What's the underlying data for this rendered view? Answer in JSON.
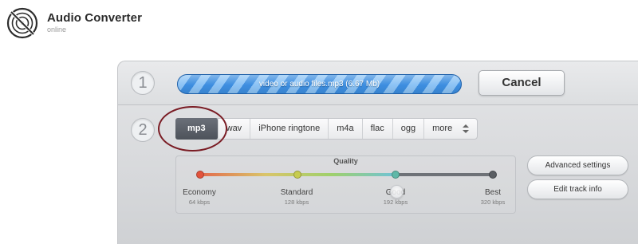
{
  "header": {
    "title": "Audio Converter",
    "subtitle": "online",
    "logo_icon": "vinyl-disc-icon"
  },
  "steps": [
    "1",
    "2"
  ],
  "upload": {
    "file_label": "video or audio files.mp3 (6.67 Mb)",
    "progress_fraction": 1.0,
    "cancel_label": "Cancel"
  },
  "formats": {
    "tabs": [
      "mp3",
      "wav",
      "iPhone ringtone",
      "m4a",
      "flac",
      "ogg"
    ],
    "selected": "mp3",
    "more_label": "more",
    "more_icon": "sort-arrows-icon"
  },
  "quality": {
    "title": "Quality",
    "levels": [
      {
        "name": "Economy",
        "rate": "64 kbps"
      },
      {
        "name": "Standard",
        "rate": "128 kbps"
      },
      {
        "name": "Good",
        "rate": "192 kbps"
      },
      {
        "name": "Best",
        "rate": "320 kbps"
      }
    ],
    "selected": "Good"
  },
  "settings": {
    "advanced_label": "Advanced settings",
    "track_info_label": "Edit track info"
  },
  "colors": {
    "annotation_circle": "#7a1c24",
    "progress_blue": "#3d8ee0",
    "active_tab": "#565b63"
  }
}
